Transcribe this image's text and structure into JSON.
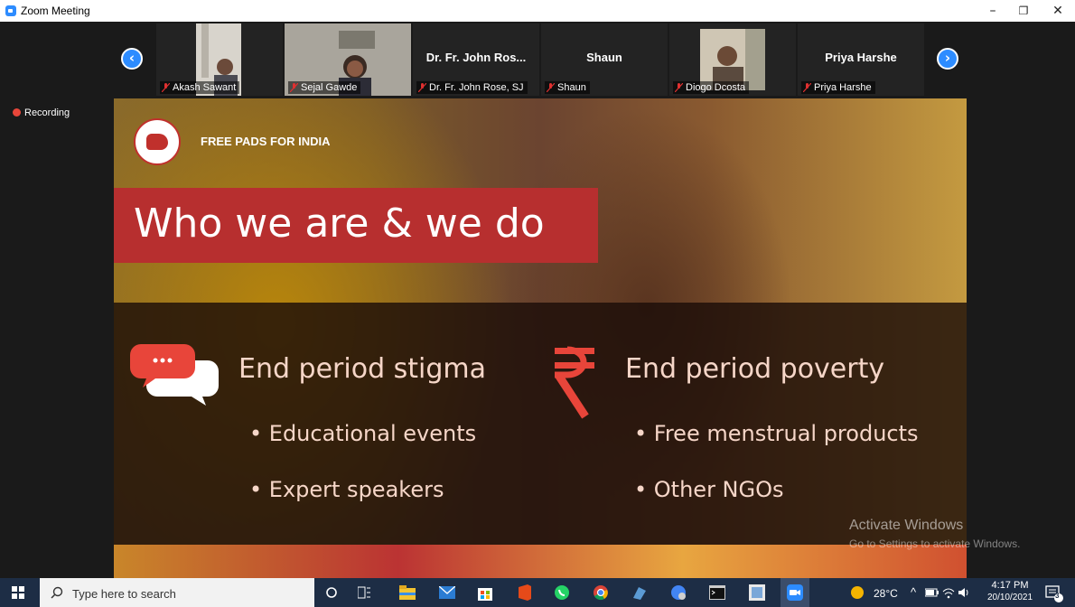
{
  "window": {
    "title": "Zoom Meeting",
    "minimize": "–",
    "maximize": "❐",
    "close": "✕"
  },
  "participants": [
    {
      "name": "Akash Sawant",
      "type": "video",
      "muted": true
    },
    {
      "name": "Sejal Gawde",
      "type": "video",
      "muted": true
    },
    {
      "name": "Dr. Fr. John Rose, SJ",
      "display": "Dr. Fr. John Ros...",
      "type": "name",
      "muted": true
    },
    {
      "name": "Shaun",
      "display": "Shaun",
      "type": "name",
      "muted": true
    },
    {
      "name": "Diogo Dcosta",
      "type": "video",
      "muted": true
    },
    {
      "name": "Priya Harshe",
      "display": "Priya Harshe",
      "type": "name",
      "muted": true
    }
  ],
  "nav": {
    "prev": "‹",
    "next": "›"
  },
  "recording": {
    "label": "Recording"
  },
  "slide": {
    "brand": "FREE PADS FOR INDIA",
    "logo_text": "FREE PADS FOR INDIA",
    "heading": "Who we are & we do",
    "left": {
      "title": "End period stigma",
      "bullets": [
        "• Educational events",
        "• Expert speakers"
      ],
      "icon": "chat-bubbles-icon"
    },
    "right": {
      "title": "End period poverty",
      "bullets": [
        "• Free menstrual products",
        "• Other NGOs"
      ],
      "icon": "rupee-icon"
    }
  },
  "watermark": {
    "line1": "Activate Windows",
    "line2": "Go to Settings to activate Windows."
  },
  "taskbar": {
    "search_placeholder": "Type here to search",
    "weather": "28°C",
    "time": "4:17 PM",
    "date": "20/10/2021",
    "notifications": "3"
  },
  "colors": {
    "zoom_blue": "#2d8cff",
    "banner_red": "#b72f2f",
    "taskbar": "#1d2d45"
  }
}
